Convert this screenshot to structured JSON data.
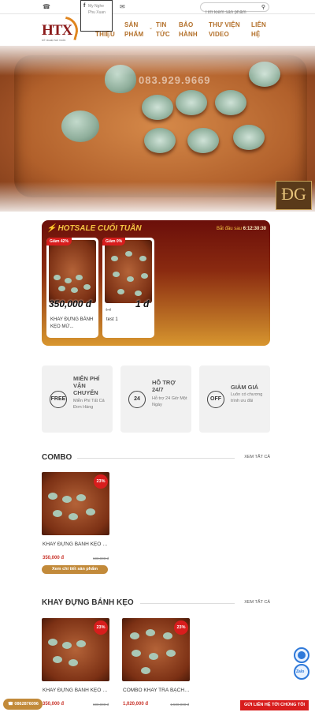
{
  "topbar": {
    "phone_icon": "phone-icon",
    "facebook_label": "My Nghe Phu Xuan",
    "mail_icon": "mail-icon",
    "search_placeholder": "Tìm kiếm sản phẩm"
  },
  "nav": {
    "logo_text": "HTX",
    "logo_tagline": "MỸ NGHỆ PHÚ XUÂN",
    "items": [
      {
        "label": "GIỚI THIỆU"
      },
      {
        "label": "SẢN PHẨM"
      },
      {
        "label": "TIN TỨC"
      },
      {
        "label": "BẢO HÀNH"
      },
      {
        "label": "THƯ VIỆN VIDEO"
      },
      {
        "label": "LIÊN HỆ"
      }
    ]
  },
  "hero": {
    "watermark": "083.929.9669",
    "corner_logo": "ĐG"
  },
  "hotsale": {
    "title": "HOTSALE CUỐI TUẦN",
    "timer_label": "Bắt đầu sau",
    "timer_value": "6:12:30:30",
    "products": [
      {
        "badge": "Giảm 42%",
        "price": "350,000 đ",
        "old_price": "",
        "name": "KHAY ĐỰNG BÁNH KẸO MỨ..."
      },
      {
        "badge": "Giảm 0%",
        "price": "1 đ",
        "old_price": "1 đ",
        "name": "test 1"
      }
    ]
  },
  "benefits": [
    {
      "title": "MIỄN PHÍ VẬN CHUYỂN",
      "desc": "Miễn Phí Tất Cả Đơn Hàng",
      "icon_label": "FREE"
    },
    {
      "title": "HỖ TRỢ 24/7",
      "desc": "Hỗ trợ 24 Giờ Một Ngày",
      "icon_label": "24"
    },
    {
      "title": "GIẢM GIÁ",
      "desc": "Luôn có chương trình ưu đãi",
      "icon_label": "OFF"
    }
  ],
  "combo": {
    "title": "COMBO",
    "more": "XEM TẤT CẢ",
    "items": [
      {
        "discount": "23%",
        "name": "KHAY ĐỰNG BÁNH KẸO MỨT",
        "price": "350,000 đ",
        "old_price": "600,000 đ",
        "button": "Xem chi tiết sản phẩm"
      }
    ]
  },
  "khay": {
    "title": "KHAY ĐỰNG BÁNH KẸO",
    "more": "XEM TẤT CẢ",
    "items": [
      {
        "discount": "23%",
        "name": "KHAY ĐỰNG BÁNH KẸO MỨT",
        "price": "350,000 đ",
        "old_price": "600,000 đ"
      },
      {
        "discount": "23%",
        "name": "COMBO KHAY TRÀ BẠCH NGỌC",
        "price": "1,020,000 đ",
        "old_price": "1,500,000 đ"
      }
    ]
  },
  "floating": {
    "hotline": "0862876096",
    "contact": "GỬI LIÊN HỆ TỚI CHÚNG TÔI",
    "zalo": "Zalo"
  }
}
